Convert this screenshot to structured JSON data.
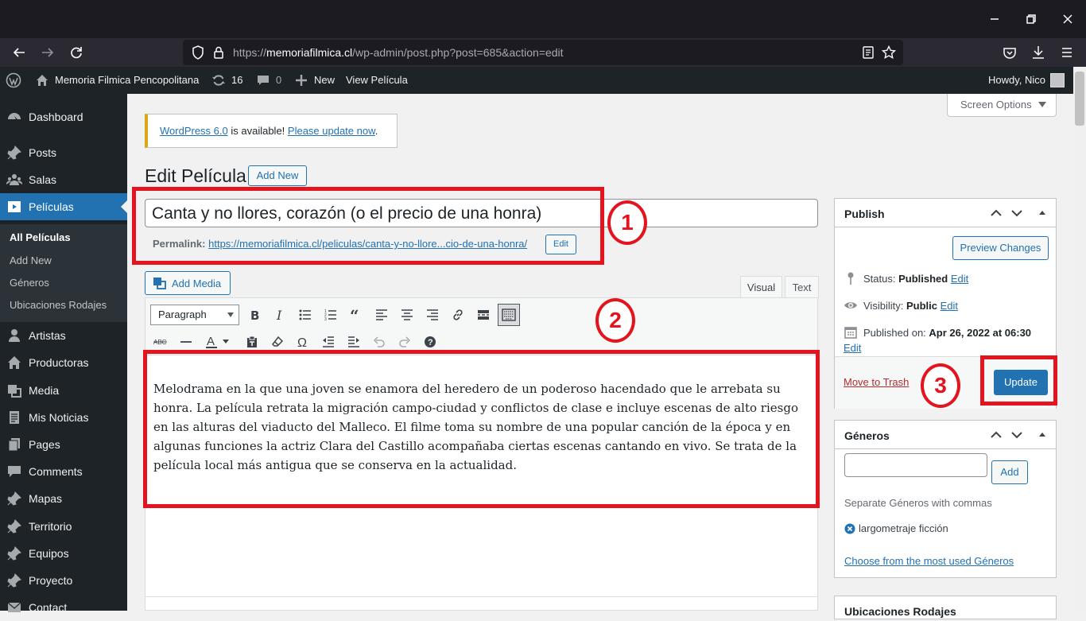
{
  "browser": {
    "url_prefix": "https://",
    "url_host": "memoriafilmica.cl",
    "url_path": "/wp-admin/post.php?post=685&action=edit"
  },
  "adminbar": {
    "site_name": "Memoria Filmica Pencopolitana",
    "updates_count": "16",
    "comments_count": "0",
    "new_label": "New",
    "view_label": "View Película",
    "howdy": "Howdy, Nico"
  },
  "sidebar": {
    "items": [
      {
        "label": "Dashboard",
        "icon": "dashboard-icon"
      },
      {
        "label": "Posts",
        "icon": "pin-icon"
      },
      {
        "label": "Salas",
        "icon": "group-icon"
      },
      {
        "label": "Películas",
        "icon": "video-icon"
      },
      {
        "label": "Artistas",
        "icon": "user-icon"
      },
      {
        "label": "Productoras",
        "icon": "home-icon"
      },
      {
        "label": "Media",
        "icon": "media-icon"
      },
      {
        "label": "Mis Noticias",
        "icon": "document-icon"
      },
      {
        "label": "Pages",
        "icon": "page-icon"
      },
      {
        "label": "Comments",
        "icon": "comment-icon"
      },
      {
        "label": "Mapas",
        "icon": "pin-icon"
      },
      {
        "label": "Territorio",
        "icon": "pin-icon"
      },
      {
        "label": "Equipos",
        "icon": "pin-icon"
      },
      {
        "label": "Proyecto",
        "icon": "pin-icon"
      },
      {
        "label": "Contact",
        "icon": "mail-icon"
      }
    ],
    "submenu": [
      "All Películas",
      "Add New",
      "Géneros",
      "Ubicaciones Rodajes"
    ]
  },
  "screen_options": "Screen Options",
  "notice": {
    "link1": "WordPress 6.0",
    "middle": " is available! ",
    "link2": "Please update now",
    "end": "."
  },
  "page": {
    "title": "Edit Película",
    "add_new": "Add New"
  },
  "post": {
    "title": "Canta y no llores, corazón (o el precio de una honra)",
    "permalink_label": "Permalink:",
    "permalink_base": "https://memoriafilmica.cl/peliculas/",
    "permalink_slug": "canta-y-no-llore...cio-de-una-honra",
    "permalink_end": "/",
    "permalink_edit": "Edit",
    "content": "Melodrama en la que una joven se enamora del heredero de un poderoso hacendado que le arrebata su honra. La película retrata la migración campo-ciudad y conflictos de clase e incluye escenas de alto riesgo en las alturas del viaducto del Malleco. El filme toma su nombre de una popular canción de la época y en algunas funciones la actriz Clara del Castillo acompañaba ciertas escenas cantando en vivo. Se trata de la película local más antigua que se conserva en la actualidad."
  },
  "editor": {
    "add_media": "Add Media",
    "tab_visual": "Visual",
    "tab_text": "Text",
    "format": "Paragraph"
  },
  "publish": {
    "title": "Publish",
    "preview": "Preview Changes",
    "status_label": "Status:",
    "status_value": "Published",
    "visibility_label": "Visibility:",
    "visibility_value": "Public",
    "published_label": "Published on:",
    "published_value": "Apr 26, 2022 at 06:30",
    "edit": "Edit",
    "trash": "Move to Trash",
    "update": "Update"
  },
  "generos": {
    "title": "Géneros",
    "add": "Add",
    "hint": "Separate Géneros with commas",
    "tag": "largometraje ficción",
    "choose": "Choose from the most used Géneros"
  },
  "next_box_title": "Ubicaciones Rodajes",
  "annotations": [
    "1",
    "2",
    "3"
  ],
  "colors": {
    "accent": "#2271b1",
    "adminbar": "#1d2327",
    "annotation": "#e3141e",
    "notice_border": "#dba617"
  }
}
